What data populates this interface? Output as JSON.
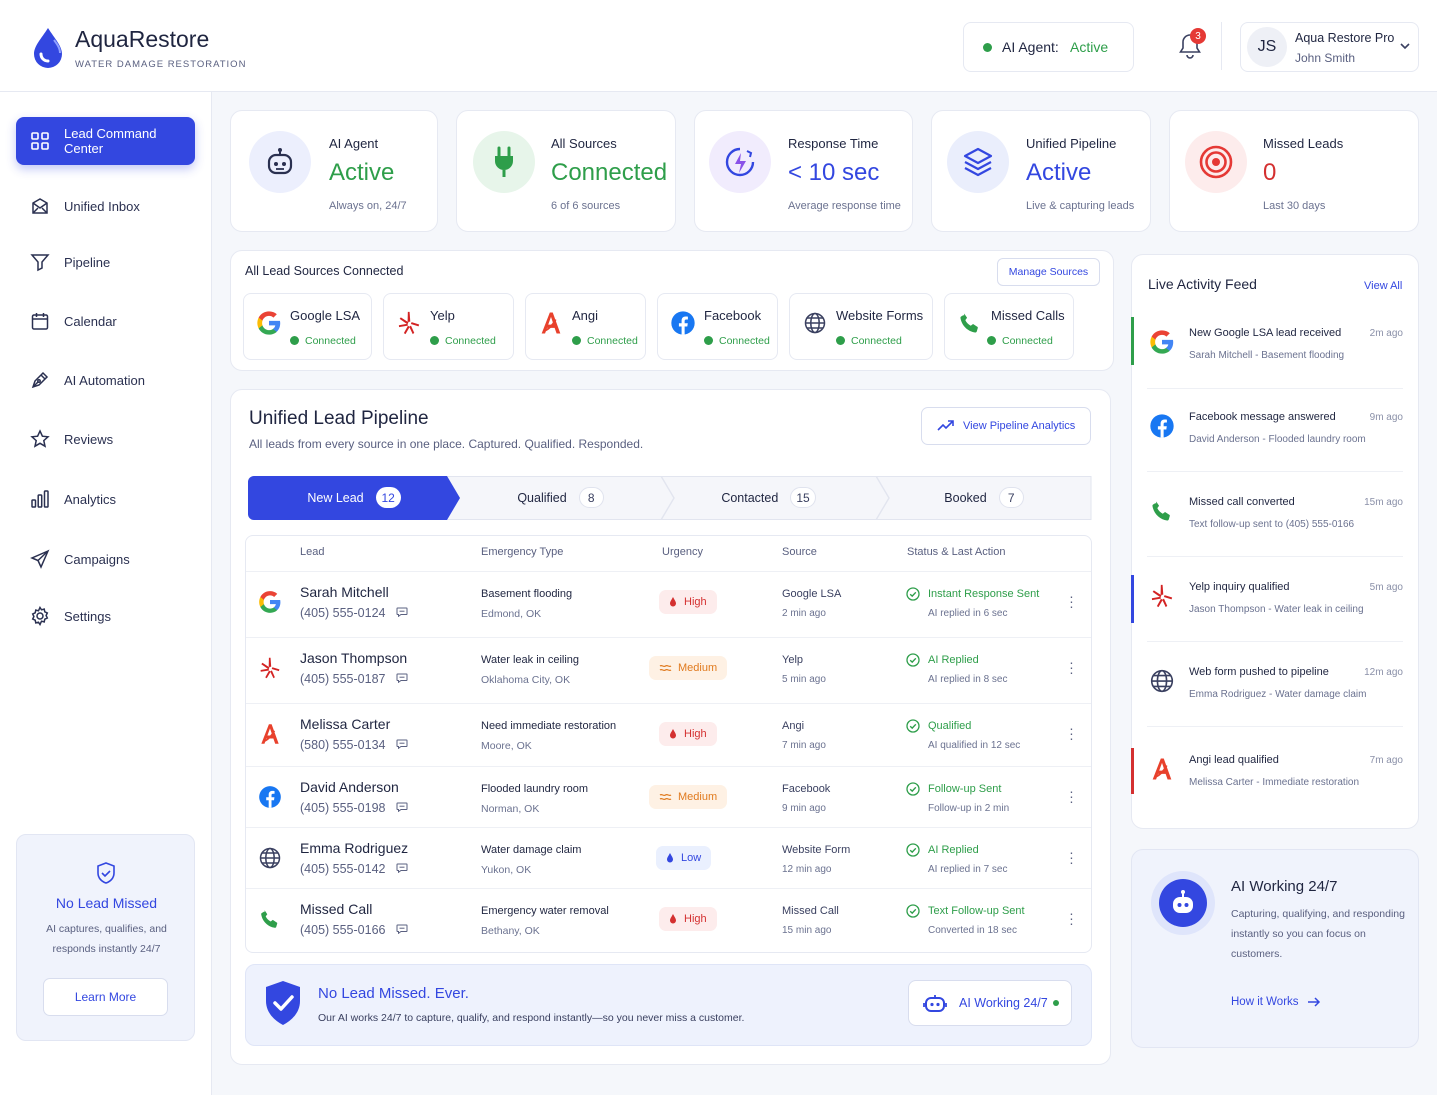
{
  "brand": {
    "name": "AquaRestore",
    "tagline": "WATER DAMAGE RESTORATION"
  },
  "header": {
    "agent_label": "AI Agent:",
    "agent_status": "Active",
    "notif_count": "3",
    "user_initials": "JS",
    "user_company": "Aqua Restore Pro",
    "user_name": "John Smith"
  },
  "sidebar": {
    "items": [
      {
        "label": "Lead Command Center",
        "icon": "grid-icon",
        "active": true
      },
      {
        "label": "Unified Inbox",
        "icon": "inbox-icon"
      },
      {
        "label": "Pipeline",
        "icon": "funnel-icon"
      },
      {
        "label": "Calendar",
        "icon": "calendar-icon"
      },
      {
        "label": "AI Automation",
        "icon": "pen-icon"
      },
      {
        "label": "Reviews",
        "icon": "star-icon"
      },
      {
        "label": "Analytics",
        "icon": "bar-chart-icon"
      },
      {
        "label": "Campaigns",
        "icon": "send-icon"
      },
      {
        "label": "Settings",
        "icon": "gear-icon"
      }
    ],
    "promo": {
      "title": "No Lead Missed",
      "text1": "AI captures, qualifies, and",
      "text2": "responds instantly 24/7",
      "button": "Learn More"
    }
  },
  "stats": [
    {
      "title": "AI Agent",
      "value": "Active",
      "sub": "Always on, 24/7",
      "color": "#2e9e4a",
      "icon": "robot-icon"
    },
    {
      "title": "All Sources",
      "value": "Connected",
      "sub": "6 of 6 sources",
      "color": "#2e9e4a",
      "icon": "plug-icon"
    },
    {
      "title": "Response Time",
      "value": "< 10 sec",
      "sub": "Average response time",
      "color": "#3347e0",
      "icon": "timer-icon"
    },
    {
      "title": "Unified Pipeline",
      "value": "Active",
      "sub": "Live & capturing leads",
      "color": "#3347e0",
      "icon": "layers-icon"
    },
    {
      "title": "Missed Leads",
      "value": "0",
      "sub": "Last 30 days",
      "color": "#d43030",
      "icon": "target-icon"
    }
  ],
  "sources": {
    "title": "All Lead Sources Connected",
    "manage": "Manage Sources",
    "items": [
      {
        "name": "Google LSA",
        "status": "Connected",
        "icon": "google-icon"
      },
      {
        "name": "Yelp",
        "status": "Connected",
        "icon": "yelp-icon"
      },
      {
        "name": "Angi",
        "status": "Connected",
        "icon": "angi-icon"
      },
      {
        "name": "Facebook",
        "status": "Connected",
        "icon": "facebook-icon"
      },
      {
        "name": "Website Forms",
        "status": "Connected",
        "icon": "globe-icon"
      },
      {
        "name": "Missed Calls",
        "status": "Connected",
        "icon": "phone-icon"
      }
    ]
  },
  "pipeline": {
    "title": "Unified Lead Pipeline",
    "subtitle": "All leads from every source in one place. Captured. Qualified. Responded.",
    "analytics": "View Pipeline Analytics",
    "stages": [
      {
        "label": "New Lead",
        "count": "12"
      },
      {
        "label": "Qualified",
        "count": "8"
      },
      {
        "label": "Contacted",
        "count": "15"
      },
      {
        "label": "Booked",
        "count": "7"
      }
    ],
    "columns": [
      "Lead",
      "Emergency Type",
      "Urgency",
      "Source",
      "Status & Last Action"
    ],
    "rows": [
      {
        "name": "Sarah Mitchell",
        "phone": "(405) 555-0124",
        "type": "Basement flooding",
        "location": "Edmond, OK",
        "urgency": "High",
        "source": "Google LSA",
        "time": "2 min ago",
        "status": "Instant Response Sent",
        "detail": "AI replied in 6 sec",
        "icon": "google-icon"
      },
      {
        "name": "Jason Thompson",
        "phone": "(405) 555-0187",
        "type": "Water leak in ceiling",
        "location": "Oklahoma City, OK",
        "urgency": "Medium",
        "source": "Yelp",
        "time": "5 min ago",
        "status": "AI Replied",
        "detail": "AI replied in 8 sec",
        "icon": "yelp-icon"
      },
      {
        "name": "Melissa Carter",
        "phone": "(580) 555-0134",
        "type": "Need immediate restoration",
        "location": "Moore, OK",
        "urgency": "High",
        "source": "Angi",
        "time": "7 min ago",
        "status": "Qualified",
        "detail": "AI qualified in 12 sec",
        "icon": "angi-icon"
      },
      {
        "name": "David Anderson",
        "phone": "(405) 555-0198",
        "type": "Flooded laundry room",
        "location": "Norman, OK",
        "urgency": "Medium",
        "source": "Facebook",
        "time": "9 min ago",
        "status": "Follow-up Sent",
        "detail": "Follow-up in 2 min",
        "icon": "facebook-icon"
      },
      {
        "name": "Emma Rodriguez",
        "phone": "(405) 555-0142",
        "type": "Water damage claim",
        "location": "Yukon, OK",
        "urgency": "Low",
        "source": "Website Form",
        "time": "12 min ago",
        "status": "AI Replied",
        "detail": "AI replied in 7 sec",
        "icon": "globe-icon"
      },
      {
        "name": "Missed Call",
        "phone": "(405) 555-0166",
        "type": "Emergency water removal",
        "location": "Bethany, OK",
        "urgency": "High",
        "source": "Missed Call",
        "time": "15 min ago",
        "status": "Text Follow-up Sent",
        "detail": "Converted in 18 sec",
        "icon": "phone-icon"
      }
    ]
  },
  "banner": {
    "title": "No Lead Missed. Ever.",
    "text": "Our AI works 24/7 to capture, qualify, and respond instantly—so you never miss a customer.",
    "badge": "AI Working 24/7"
  },
  "feed": {
    "title": "Live Activity Feed",
    "view_all": "View All",
    "items": [
      {
        "title": "New Google LSA lead received",
        "time": "2m ago",
        "detail": "Sarah Mitchell - Basement flooding",
        "icon": "google-icon",
        "bar": "#2e9e4a"
      },
      {
        "title": "Facebook message answered",
        "time": "9m ago",
        "detail": "David Anderson - Flooded laundry room",
        "icon": "facebook-icon",
        "bar": ""
      },
      {
        "title": "Missed call converted",
        "time": "15m ago",
        "detail": "Text follow-up sent to (405) 555-0166",
        "icon": "phone-icon",
        "bar": ""
      },
      {
        "title": "Yelp inquiry qualified",
        "time": "5m ago",
        "detail": "Jason Thompson - Water leak in ceiling",
        "icon": "yelp-icon",
        "bar": "#3347e0"
      },
      {
        "title": "Web form pushed to pipeline",
        "time": "12m ago",
        "detail": "Emma Rodriguez - Water damage claim",
        "icon": "globe-icon",
        "bar": ""
      },
      {
        "title": "Angi lead qualified",
        "time": "7m ago",
        "detail": "Melissa Carter - Immediate restoration",
        "icon": "angi-icon",
        "bar": "#d43030"
      }
    ]
  },
  "ai_card": {
    "title": "AI Working 24/7",
    "l1": "Capturing, qualifying, and responding",
    "l2": "instantly so you can focus on",
    "l3": "customers.",
    "link": "How it Works"
  }
}
